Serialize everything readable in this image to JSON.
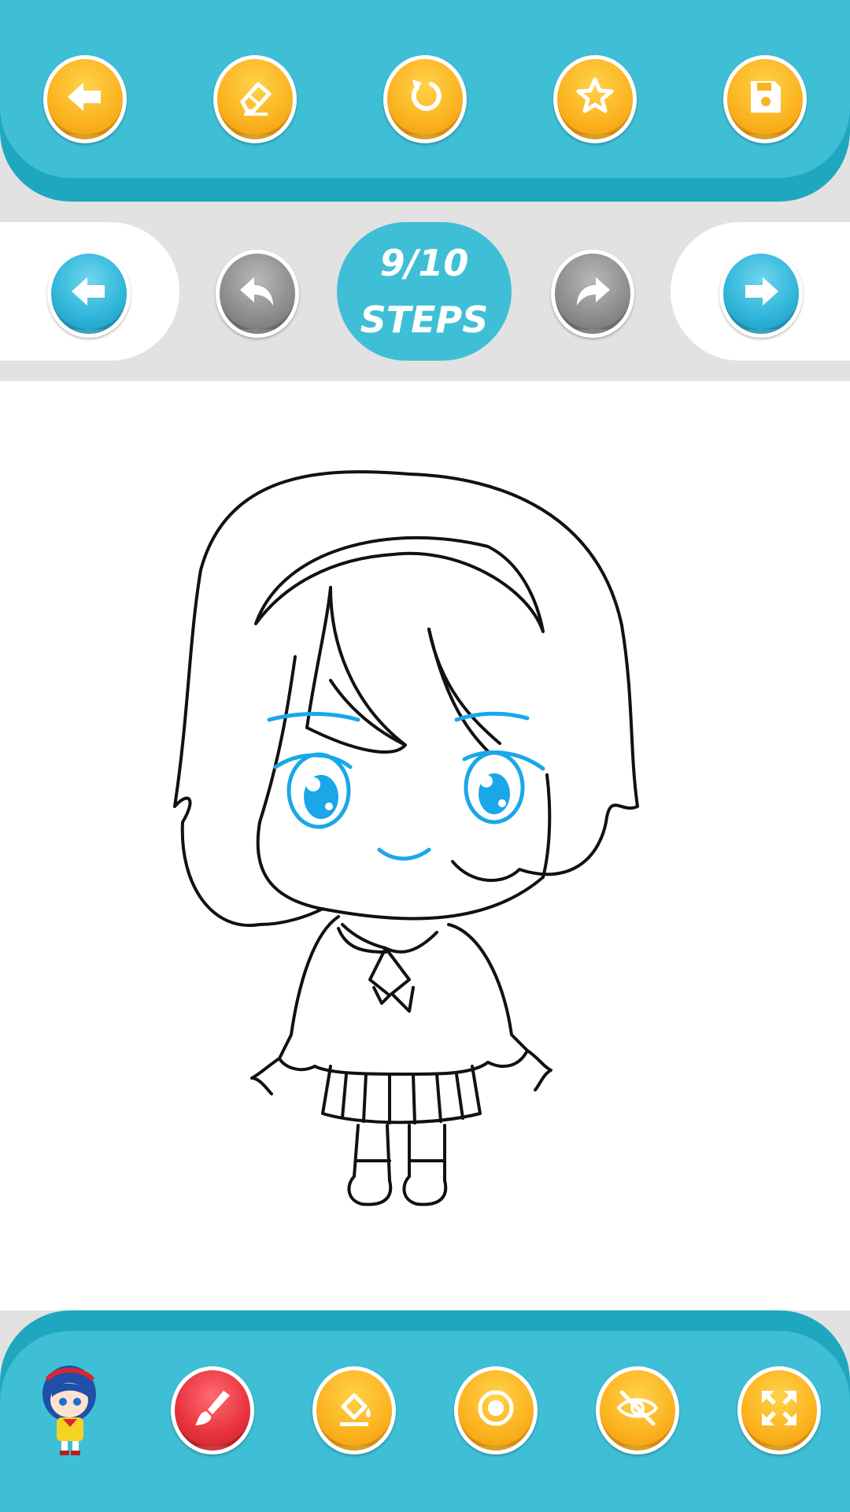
{
  "top_toolbar": {
    "buttons": [
      {
        "name": "back-button",
        "icon": "arrow-left-icon"
      },
      {
        "name": "eraser-button",
        "icon": "eraser-icon"
      },
      {
        "name": "reset-button",
        "icon": "refresh-icon"
      },
      {
        "name": "favorite-button",
        "icon": "star-icon"
      },
      {
        "name": "save-button",
        "icon": "floppy-disk-icon"
      }
    ],
    "button_color": "#fbb320"
  },
  "step_navigation": {
    "steps_current": "9/10",
    "steps_label": "STEPS",
    "prev_step_icon": "arrow-left-icon",
    "undo_icon": "undo-icon",
    "redo_icon": "redo-icon",
    "next_step_icon": "arrow-right-icon"
  },
  "bottom_toolbar": {
    "tools": [
      {
        "name": "character-thumbnail",
        "icon": "chibi-girl-thumbnail"
      },
      {
        "name": "brush-button",
        "icon": "paintbrush-icon"
      },
      {
        "name": "fill-button",
        "icon": "paint-bucket-icon"
      },
      {
        "name": "brush-size-button",
        "icon": "circle-icon"
      },
      {
        "name": "hide-guide-button",
        "icon": "eye-off-icon"
      },
      {
        "name": "fullscreen-button",
        "icon": "expand-icon"
      }
    ]
  },
  "colors": {
    "toolbar_teal": "#3fbfd5",
    "accent_orange": "#fbb320",
    "accent_red": "#e8333d",
    "accent_blue": "#2fb5d9",
    "disabled_gray": "#8d8d8d",
    "drawing_highlight": "#1aa7e8"
  }
}
